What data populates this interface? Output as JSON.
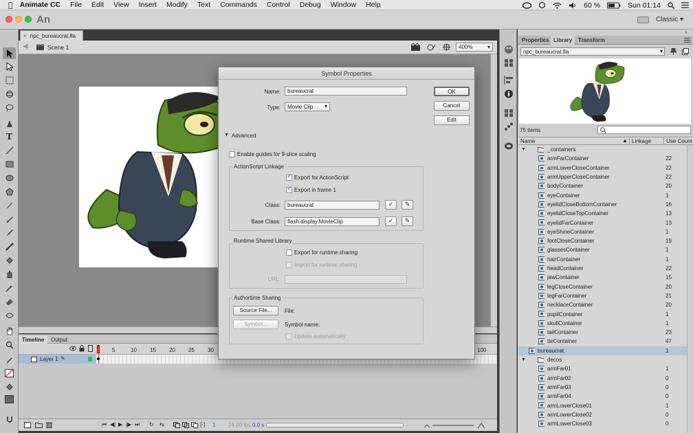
{
  "menubar": {
    "app_name": "Animate CC",
    "items": [
      "File",
      "Edit",
      "View",
      "Insert",
      "Modify",
      "Text",
      "Commands",
      "Control",
      "Debug",
      "Window",
      "Help"
    ],
    "battery": "60 %",
    "clock": "Sun 01:14"
  },
  "app": {
    "logo": "An",
    "workspace": "Classic"
  },
  "document": {
    "tab_name": "npc_bureaucrat.fla",
    "scene": "Scene 1",
    "zoom": "400%"
  },
  "timeline": {
    "tabs": [
      "Timeline",
      "Output"
    ],
    "layer_name": "Layer 1",
    "frame_numbers": [
      "1",
      "5",
      "10",
      "15",
      "20",
      "25",
      "30",
      "100"
    ],
    "current_frame": "1",
    "fps": "24.00 fps",
    "time": "0.0 s"
  },
  "dialog": {
    "title": "Symbol Properties",
    "name_label": "Name:",
    "name_value": "bureaucrat",
    "type_label": "Type:",
    "type_value": "Movie Clip",
    "ok_label": "OK",
    "cancel_label": "Cancel",
    "edit_label": "Edit",
    "advanced_label": "Advanced",
    "nine_slice_label": "Enable guides for 9-slice scaling",
    "as_linkage": {
      "title": "ActionScript Linkage",
      "export_as_label": "Export for ActionScript",
      "export_as_checked": true,
      "export_frame1_label": "Export in frame 1",
      "export_frame1_checked": true,
      "class_label": "Class:",
      "class_value": "bureaucrat",
      "base_class_label": "Base Class:",
      "base_class_value": "flash.display.MovieClip"
    },
    "runtime_shared": {
      "title": "Runtime Shared Library",
      "export_runtime_label": "Export for runtime sharing",
      "import_runtime_label": "Import for runtime sharing",
      "url_label": "URL:"
    },
    "authortime": {
      "title": "Authortime Sharing",
      "source_file_label": "Source File...",
      "file_label": "File:",
      "symbol_button_label": "Symbol...",
      "symbol_name_label": "Symbol name:",
      "update_auto_label": "Update automatically"
    }
  },
  "library": {
    "tabs": [
      "Properties",
      "Library",
      "Transform"
    ],
    "active_tab": "Library",
    "file": "npc_bureaucrat.fla",
    "count": "75 items",
    "columns": [
      "Name",
      "Linkage",
      "Use Count"
    ],
    "items": [
      {
        "name": "_containers",
        "count": "",
        "indent": 0,
        "type": "folder"
      },
      {
        "name": "armFarContainer",
        "count": "22",
        "indent": 1,
        "type": "mc"
      },
      {
        "name": "armLowerCloseContainer",
        "count": "22",
        "indent": 1,
        "type": "mc"
      },
      {
        "name": "armUpperCloseContainer",
        "count": "22",
        "indent": 1,
        "type": "mc"
      },
      {
        "name": "bodyContainer",
        "count": "20",
        "indent": 1,
        "type": "mc"
      },
      {
        "name": "eyeContainer",
        "count": "1",
        "indent": 1,
        "type": "mc"
      },
      {
        "name": "eyelidCloseBottomContainer",
        "count": "16",
        "indent": 1,
        "type": "mc"
      },
      {
        "name": "eyelidCloseTopContainer",
        "count": "13",
        "indent": 1,
        "type": "mc"
      },
      {
        "name": "eyelidFarContainer",
        "count": "13",
        "indent": 1,
        "type": "mc"
      },
      {
        "name": "eyeShineContainer",
        "count": "1",
        "indent": 1,
        "type": "mc"
      },
      {
        "name": "footCloseContainer",
        "count": "19",
        "indent": 1,
        "type": "mc"
      },
      {
        "name": "glassesContainer",
        "count": "1",
        "indent": 1,
        "type": "mc"
      },
      {
        "name": "hairContainer",
        "count": "1",
        "indent": 1,
        "type": "mc"
      },
      {
        "name": "headContainer",
        "count": "22",
        "indent": 1,
        "type": "mc"
      },
      {
        "name": "jawContainer",
        "count": "15",
        "indent": 1,
        "type": "mc"
      },
      {
        "name": "legCloseContainer",
        "count": "20",
        "indent": 1,
        "type": "mc"
      },
      {
        "name": "legFarContainer",
        "count": "21",
        "indent": 1,
        "type": "mc"
      },
      {
        "name": "necklaceContainer",
        "count": "20",
        "indent": 1,
        "type": "mc"
      },
      {
        "name": "pupilContainer",
        "count": "1",
        "indent": 1,
        "type": "mc"
      },
      {
        "name": "skullContainer",
        "count": "1",
        "indent": 1,
        "type": "mc"
      },
      {
        "name": "tailContainer",
        "count": "23",
        "indent": 1,
        "type": "mc"
      },
      {
        "name": "tieContainer",
        "count": "47",
        "indent": 1,
        "type": "mc"
      },
      {
        "name": "bureaucrat",
        "count": "1",
        "indent": 0,
        "type": "mc",
        "selected": true
      },
      {
        "name": "decos",
        "count": "",
        "indent": 0,
        "type": "folder"
      },
      {
        "name": "armFar01",
        "count": "1",
        "indent": 1,
        "type": "mc"
      },
      {
        "name": "armFar02",
        "count": "0",
        "indent": 1,
        "type": "mc"
      },
      {
        "name": "armFar03",
        "count": "0",
        "indent": 1,
        "type": "mc"
      },
      {
        "name": "armFar04",
        "count": "0",
        "indent": 1,
        "type": "mc"
      },
      {
        "name": "armLowerClose01",
        "count": "1",
        "indent": 1,
        "type": "mc"
      },
      {
        "name": "armLowerClose02",
        "count": "0",
        "indent": 1,
        "type": "mc"
      },
      {
        "name": "armLowerClose03",
        "count": "0",
        "indent": 1,
        "type": "mc"
      }
    ]
  }
}
